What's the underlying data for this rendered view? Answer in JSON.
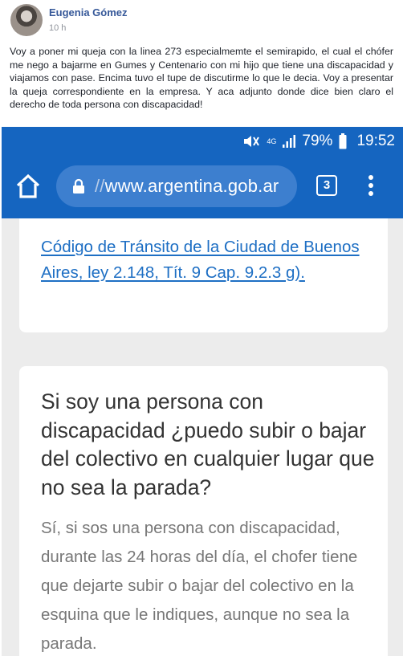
{
  "post": {
    "author": "Eugenia Gómez",
    "time": "10 h",
    "text": "Voy a poner mi queja con la linea 273 especialmemte el semirapido, el cual el chófer me nego a bajarme en Gumes y Centenario con mi hijo que tiene una discapacidad y viajamos con pase. Encima tuvo el tupe de discutirme lo que le decia. Voy a presentar la queja correspondiente en la empresa. Y aca adjunto donde dice bien claro el derecho de toda persona con discapacidad!"
  },
  "status_bar": {
    "network": "4G",
    "battery": "79%",
    "clock": "19:52",
    "icons": [
      "mute-icon",
      "signal-icon",
      "battery-icon"
    ]
  },
  "browser": {
    "url_prefix": "//",
    "url_domain": "www.argentina.gob.ar",
    "tab_count": "3",
    "icons": [
      "home-icon",
      "lock-icon",
      "overflow-menu-icon"
    ]
  },
  "content": {
    "law_link": "Código de Tránsito de la Ciudad de Buenos Aires, ley 2.148, Tít. 9 Cap. 9.2.3 g).",
    "question": "Si soy una persona con discapacidad ¿puedo subir o bajar del colectivo en cualquier lugar que no sea la parada?",
    "answer": "Sí, si sos una persona con discapacidad, durante las 24 horas del día, el chofer tiene que dejarte subir o bajar del colectivo en la esquina que le indiques, aunque no sea la parada."
  },
  "colors": {
    "brand_blue": "#1565c0",
    "link": "#1e6fc4",
    "facebook_name": "#365899"
  }
}
